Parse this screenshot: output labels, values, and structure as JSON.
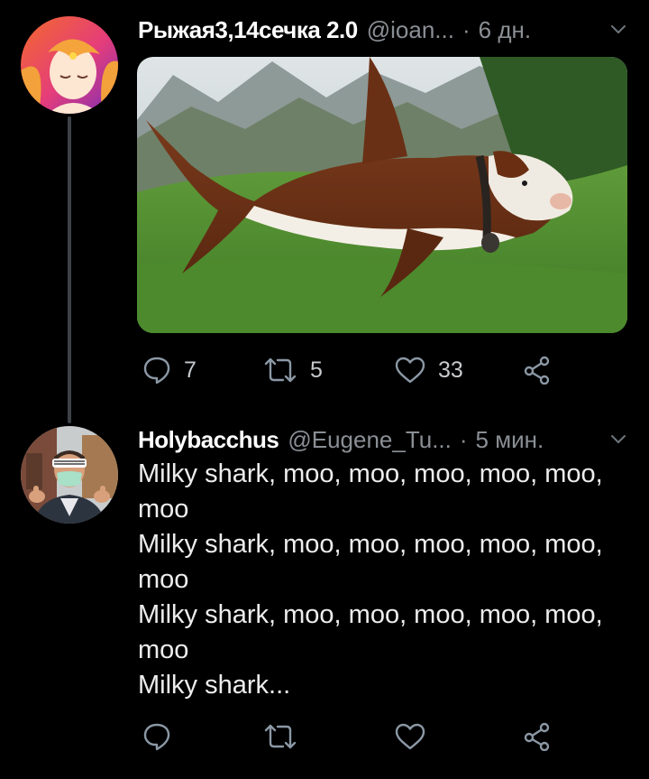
{
  "tweets": [
    {
      "name": "Рыжая3,14сечка 2.0",
      "handle": "@ioan...",
      "dot": "·",
      "time": "6 дн.",
      "media_alt": "shark with cow head and bell in a mountain meadow",
      "replies": "7",
      "retweets": "5",
      "likes": "33"
    },
    {
      "name": "Holybacchus",
      "handle": "@Eugene_Tu...",
      "dot": "·",
      "time": "5 мин.",
      "lines": [
        "Milky shark, moo, moo, moo, moo, moo,",
        "moo",
        "Milky shark, moo, moo, moo, moo, moo,",
        "moo",
        "Milky shark, moo, moo, moo, moo, moo,",
        "moo",
        "Milky shark..."
      ]
    }
  ],
  "colors": {
    "background": "#000000",
    "name": "#ffffff",
    "muted": "#8a8f95",
    "icon": "#8b98a5",
    "thread_line": "#3d4248"
  }
}
